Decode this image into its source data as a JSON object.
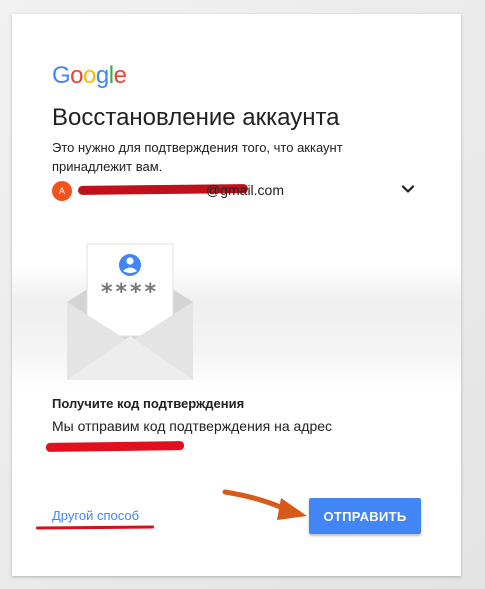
{
  "logo": {
    "letters": [
      "G",
      "o",
      "o",
      "g",
      "l",
      "e"
    ],
    "colors": [
      "#4285f4",
      "#ea4335",
      "#fbbc05",
      "#4285f4",
      "#34a853",
      "#ea4335"
    ]
  },
  "header": {
    "title": "Восстановление аккаунта",
    "subtitle": "Это нужно для подтверждения того, что аккаунт принадлежит вам."
  },
  "account": {
    "avatar_letter": "A",
    "email_suffix": "@gmail.com",
    "avatar_color": "#f4511e",
    "dropdown_icon": "chevron-down-icon"
  },
  "illustration": {
    "masked_code": "****",
    "person_icon": "person-icon"
  },
  "verification": {
    "heading": "Получите код подтверждения",
    "text": "Мы отправим код подтверждения на адрес"
  },
  "actions": {
    "other_method_label": "Другой способ",
    "send_label": "ОТПРАВИТЬ",
    "send_color": "#4285f4"
  },
  "annotations": {
    "redaction_color": "#d4101a",
    "arrow_color": "#d85a1a"
  }
}
